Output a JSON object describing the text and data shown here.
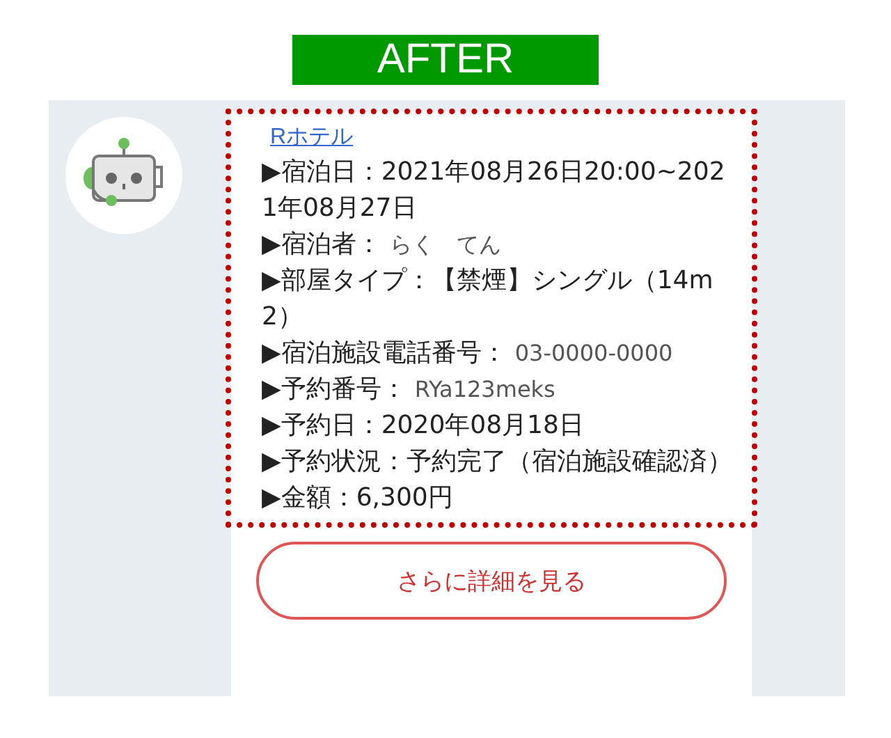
{
  "banner": {
    "text": "AFTER"
  },
  "message": {
    "link": "Rホテル",
    "details": [
      {
        "label": "▶宿泊日：",
        "value": "2021年08月26日20:00~2021年08月27日",
        "kind": "plain"
      },
      {
        "label": "▶宿泊者：",
        "value": "らく　てん",
        "kind": "muted"
      },
      {
        "label": "▶部屋タイプ：",
        "value": "【禁煙】シングル（14m2）",
        "kind": "plain"
      },
      {
        "label": "▶宿泊施設電話番号：",
        "value": "03-0000-0000",
        "kind": "muted"
      },
      {
        "label": "▶予約番号：",
        "value": "RYa123meks",
        "kind": "muted"
      },
      {
        "label": "▶予約日：",
        "value": "2020年08月18日",
        "kind": "plain"
      },
      {
        "label": "▶予約状況：",
        "value": "予約完了（宿泊施設確認済）",
        "kind": "plain"
      },
      {
        "label": "▶金額：",
        "value": "6,300円",
        "kind": "plain"
      }
    ],
    "button": "さらに詳細を見る"
  }
}
